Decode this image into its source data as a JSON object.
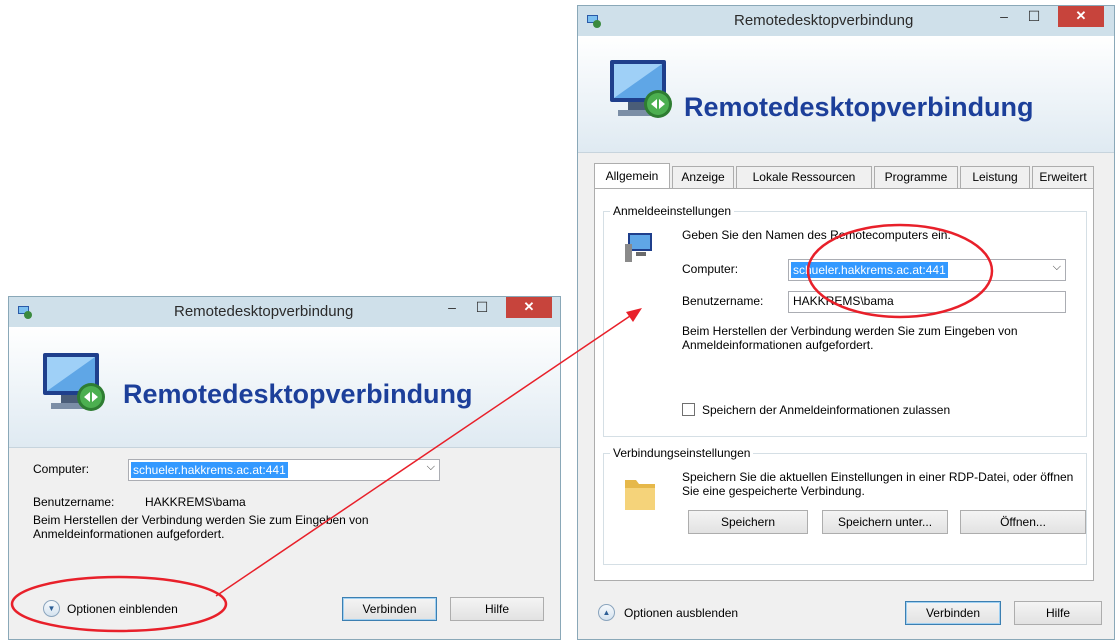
{
  "small": {
    "title": "Remotedesktopverbindung",
    "banner": "Remotedesktopverbindung",
    "computer_label": "Computer:",
    "computer_value": "schueler.hakkrems.ac.at:441",
    "user_label": "Benutzername:",
    "user_value": "HAKKREMS\\bama",
    "info": "Beim Herstellen der Verbindung werden Sie zum Eingeben von Anmeldeinformationen aufgefordert.",
    "options": "Optionen einblenden",
    "connect": "Verbinden",
    "help": "Hilfe"
  },
  "large": {
    "title": "Remotedesktopverbindung",
    "banner": "Remotedesktopverbindung",
    "tabs": [
      "Allgemein",
      "Anzeige",
      "Lokale Ressourcen",
      "Programme",
      "Leistung",
      "Erweitert"
    ],
    "login_group": "Anmeldeeinstellungen",
    "login_hint": "Geben Sie den Namen des Remotecomputers ein.",
    "computer_label": "Computer:",
    "computer_value": "schueler.hakkrems.ac.at:441",
    "user_label": "Benutzername:",
    "user_value": "HAKKREMS\\bama",
    "info": "Beim Herstellen der Verbindung werden Sie zum Eingeben von Anmeldeinformationen aufgefordert.",
    "save_creds": "Speichern der Anmeldeinformationen zulassen",
    "conn_group": "Verbindungseinstellungen",
    "conn_info": "Speichern Sie die aktuellen Einstellungen in einer RDP-Datei, oder öffnen Sie eine gespeicherte Verbindung.",
    "save": "Speichern",
    "save_as": "Speichern unter...",
    "open": "Öffnen...",
    "options": "Optionen ausblenden",
    "connect": "Verbinden",
    "help": "Hilfe"
  },
  "colors": {
    "annotation": "#e8202a",
    "banner_title": "#1c3f9a",
    "close": "#c7443c"
  }
}
